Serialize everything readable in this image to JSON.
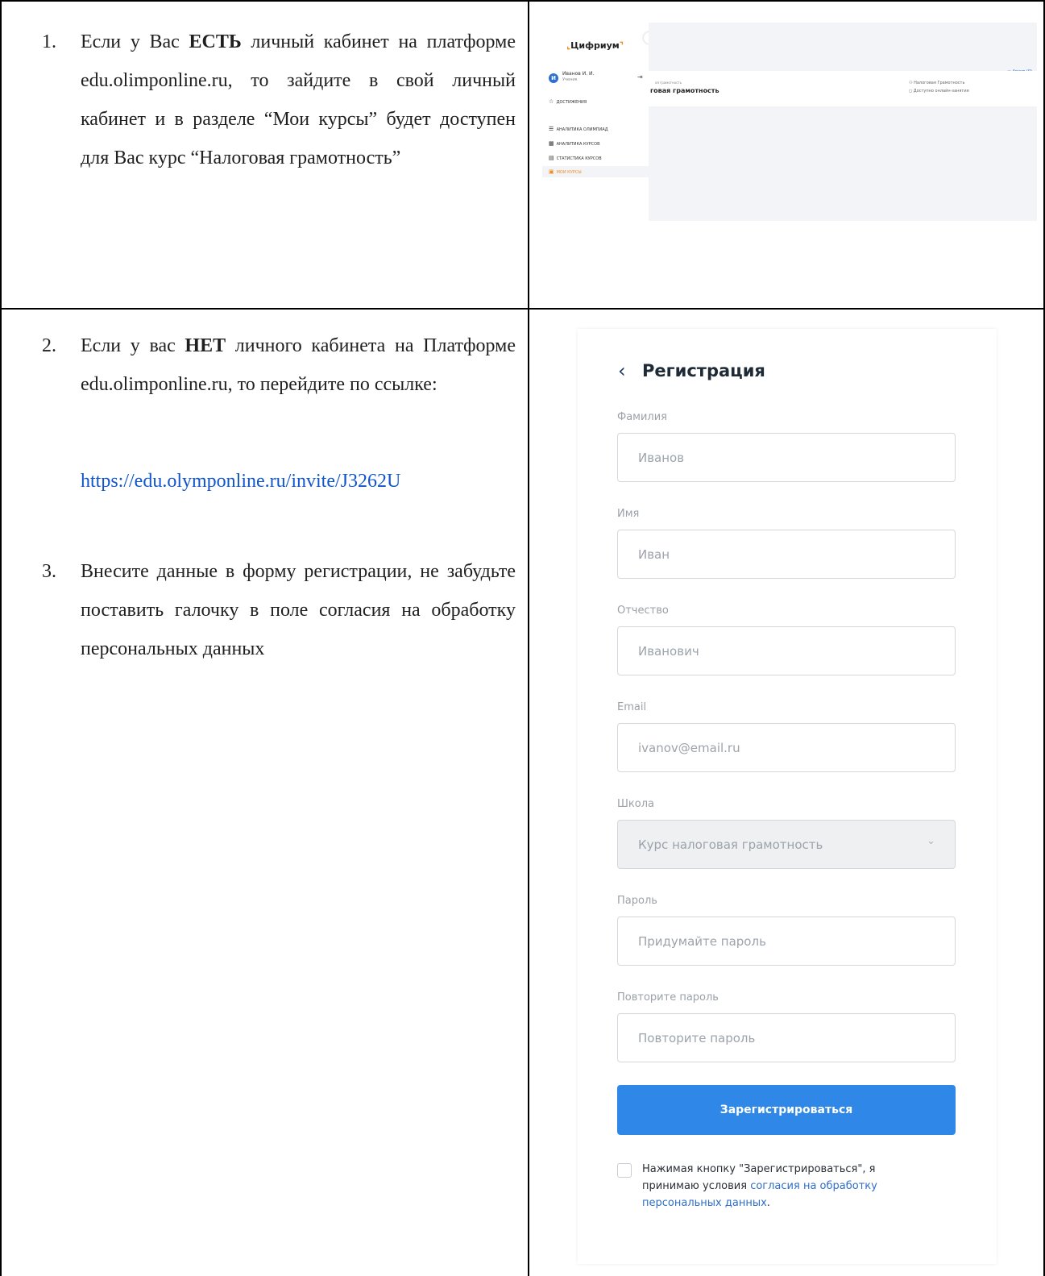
{
  "step1": {
    "number": "1.",
    "text_before": "Если у Вас",
    "text_bold": "ЕСТЬ",
    "text_after": "личный кабинет на платформе edu.olimponline.ru, то зайдите в свой личный кабинет и в разделе “Мои курсы” будет доступен для Вас курс “Налоговая грамотность”"
  },
  "step2": {
    "number": "2.",
    "text_before": "Если у вас",
    "text_bold": "НЕТ",
    "text_after": "личного кабинета на Платформе edu.olimponline.ru, то перейдите по ссылке:",
    "link": "https://edu.olymponline.ru/invite/J3262U"
  },
  "step3": {
    "number": "3.",
    "text": "Внесите данные в форму регистрации, не забудьте поставить галочку в поле согласия на обработку персональных данных"
  },
  "dashboard": {
    "logo": "Цифриум",
    "collapse_icon": "‹",
    "user_initial": "И",
    "user_name": "Иванов И. И.",
    "user_role": "Ученик",
    "menu": [
      {
        "icon": "star-icon",
        "label": "достижения"
      },
      {
        "icon": "list-icon",
        "label": "аналитика олимпиад"
      },
      {
        "icon": "table-icon",
        "label": "аналитика курсов"
      },
      {
        "icon": "doc-icon",
        "label": "статистика курсов"
      },
      {
        "icon": "courses-icon",
        "label": "мои курсы"
      }
    ],
    "archive": "Архив (0)",
    "breadcrumb": "ая грамотность",
    "course_title": "говая грамотность",
    "info_1": "Налоговая Грамотность",
    "info_2": "Доступно онлайн-занятия"
  },
  "registration": {
    "back_icon": "chevron-left-icon",
    "title": "Регистрация",
    "fields": {
      "lastname": {
        "label": "Фамилия",
        "placeholder": "Иванов"
      },
      "firstname": {
        "label": "Имя",
        "placeholder": "Иван"
      },
      "patronymic": {
        "label": "Отчество",
        "placeholder": "Иванович"
      },
      "email": {
        "label": "Email",
        "placeholder": "ivanov@email.ru"
      },
      "school": {
        "label": "Школа",
        "value": "Курс налоговая грамотность"
      },
      "password": {
        "label": "Пароль",
        "placeholder": "Придумайте пароль"
      },
      "password_repeat": {
        "label": "Повторите пароль",
        "placeholder": "Повторите пароль"
      }
    },
    "submit": "Зарегистрироваться",
    "consent_text": "Нажимая кнопку \"Зарегистрироваться\", я принимаю условия",
    "consent_link": "согласия на обработку персональных данных",
    "consent_end": "."
  }
}
